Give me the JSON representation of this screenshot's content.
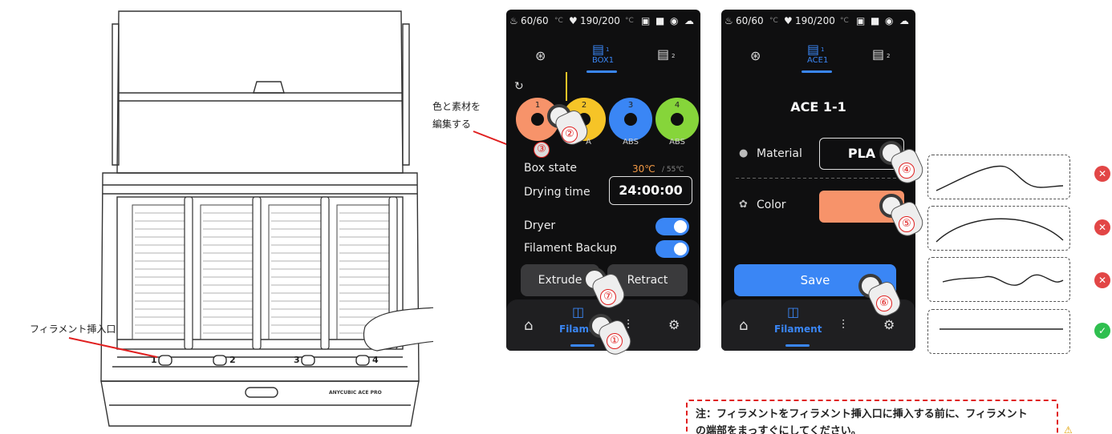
{
  "left_panel": {
    "callout_filament_inlet": "フィラメント挿入口",
    "callout_edit": [
      "色と素材を",
      "編集する"
    ],
    "slot_labels": [
      "1",
      "2",
      "3",
      "4"
    ],
    "brand": "ANYCUBIC ACE PRO"
  },
  "screen1": {
    "status": {
      "bed": "60/60",
      "bed_unit": "°C",
      "nozzle": "190/200",
      "nozzle_unit": "°C"
    },
    "tabs": {
      "active_label": "BOX1",
      "box2_sub": "2",
      "box1_sub": "1"
    },
    "spools": [
      {
        "num": "1",
        "color": "#f7936a",
        "material": ""
      },
      {
        "num": "2",
        "color": "#f6c427",
        "material": "A"
      },
      {
        "num": "3",
        "color": "#3a86f5",
        "material": "ABS"
      },
      {
        "num": "4",
        "color": "#86d53a",
        "material": "ABS"
      }
    ],
    "box_state_label": "Box state",
    "box_state_value": "30℃",
    "box_state_limit": "/ 55℃",
    "drying_time_label": "Drying time",
    "drying_time_value": "24:00:00",
    "dryer_label": "Dryer",
    "backup_label": "Filament Backup",
    "extrude_label": "Extrude",
    "retract_label": "Retract",
    "nav_label": "Filament"
  },
  "screen2": {
    "status": {
      "bed": "60/60",
      "bed_unit": "°C",
      "nozzle": "190/200",
      "nozzle_unit": "°C"
    },
    "tabs": {
      "active_label": "ACE1",
      "box1_sub": "1",
      "box2_sub": "2"
    },
    "title": "ACE 1-1",
    "material_label": "Material",
    "material_value": "PLA",
    "color_label": "Color",
    "color_value_hex": "#f7936a",
    "save_label": "Save",
    "nav_label": "Filament"
  },
  "steps": [
    "①",
    "②",
    "③",
    "④",
    "⑤",
    "⑥",
    "⑦"
  ],
  "checks": [
    {
      "result": "bad",
      "symbol": "✕"
    },
    {
      "result": "bad",
      "symbol": "✕"
    },
    {
      "result": "bad",
      "symbol": "✕"
    },
    {
      "result": "good",
      "symbol": "✓"
    }
  ],
  "note": {
    "line1": "注：フィラメントをフィラメント挿入口に挿入する前に、フィラメント",
    "line2": "の端部をまっすぐにしてください。"
  },
  "colors": {
    "accent": "#3a86f5",
    "bad": "#e24646",
    "good": "#2fbf4f",
    "note_border": "#e02020"
  }
}
